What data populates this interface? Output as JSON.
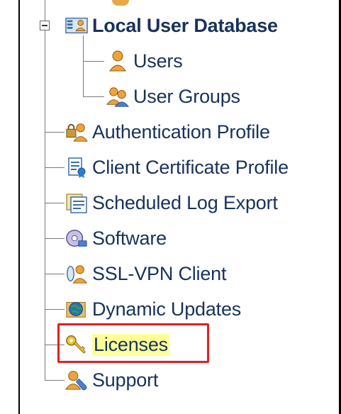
{
  "tree": {
    "root": {
      "label": "Local User Database",
      "icon": "database-users-icon"
    },
    "children_root": [
      {
        "label": "Users",
        "icon": "user-icon"
      },
      {
        "label": "User Groups",
        "icon": "user-group-icon"
      }
    ],
    "items": [
      {
        "label": "Authentication Profile",
        "icon": "authentication-profile-icon"
      },
      {
        "label": "Client Certificate Profile",
        "icon": "certificate-profile-icon"
      },
      {
        "label": "Scheduled Log Export",
        "icon": "scheduled-log-export-icon"
      },
      {
        "label": "Software",
        "icon": "software-icon"
      },
      {
        "label": "SSL-VPN Client",
        "icon": "ssl-vpn-client-icon"
      },
      {
        "label": "Dynamic Updates",
        "icon": "dynamic-updates-icon"
      },
      {
        "label": "Licenses",
        "icon": "key-icon"
      },
      {
        "label": "Support",
        "icon": "support-icon"
      }
    ]
  },
  "selection": {
    "selected_item": "Licenses",
    "highlight_color": "#ffff99",
    "annotation_color": "#e02020"
  }
}
